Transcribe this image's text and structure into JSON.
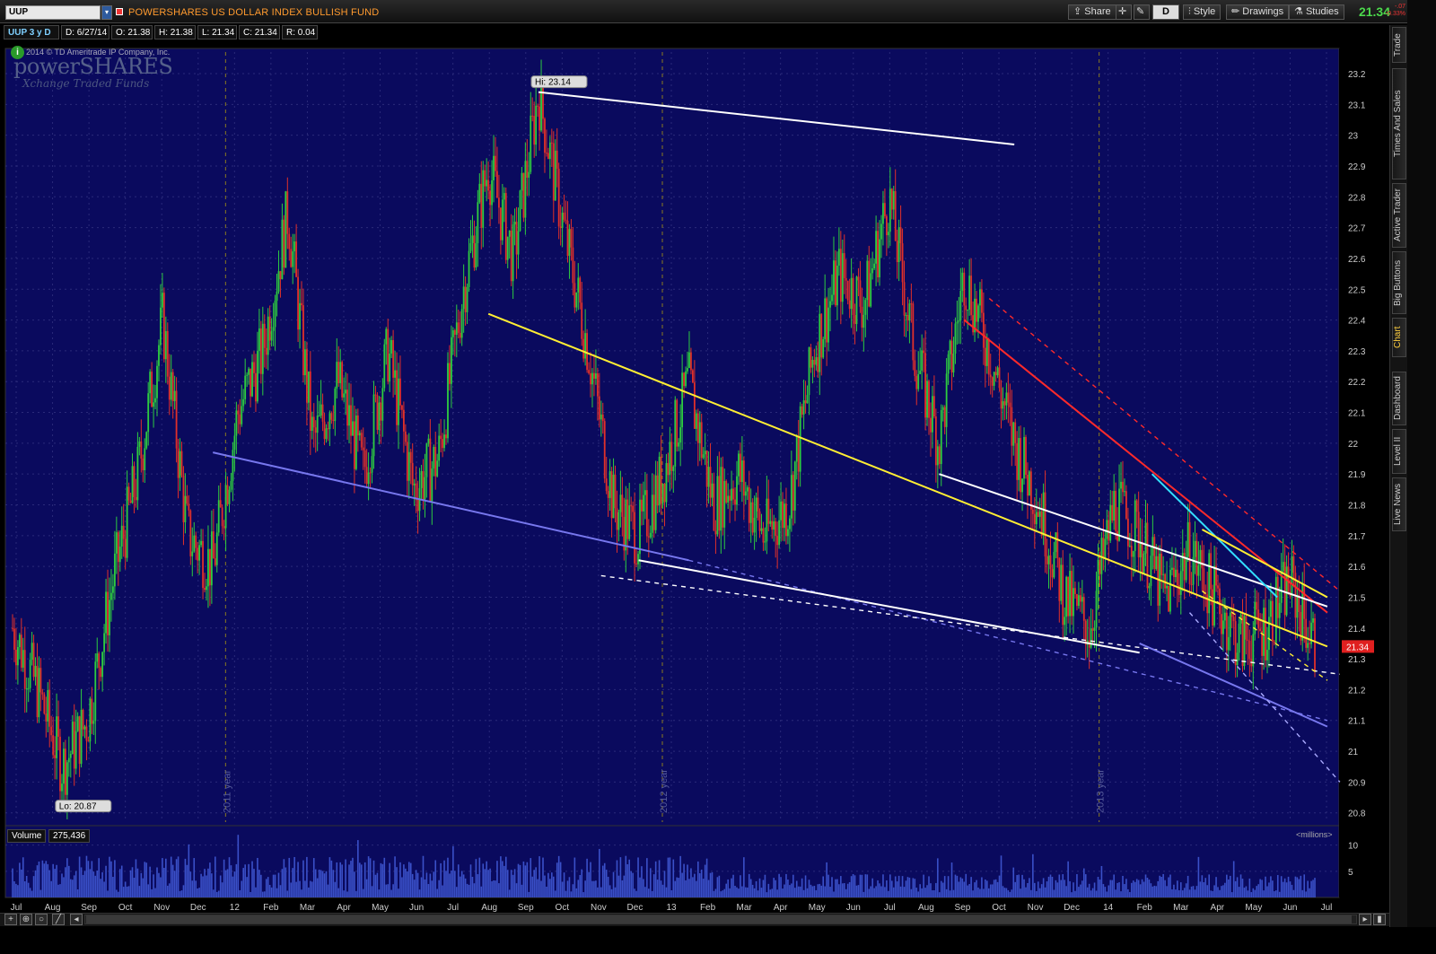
{
  "toolbar": {
    "symbol": "UUP",
    "fund_name": "POWERSHARES US DOLLAR INDEX BULLISH FUND",
    "share_label": "Share",
    "d_label": "D",
    "style_label": "Style",
    "drawings_label": "Drawings",
    "studies_label": "Studies",
    "last_price": "21.34",
    "change_line1": "-.07",
    "change_line2": "-0.33%"
  },
  "infobar": {
    "symbol_period": "UUP 3 y D",
    "date": "D: 6/27/14",
    "open": "O: 21.38",
    "high": "H: 21.38",
    "low": "L: 21.34",
    "close": "C: 21.34",
    "range": "R: 0.04"
  },
  "logo": {
    "copyright": "2014 © TD Ameritrade IP Company, Inc.",
    "brand": "powerSHARES",
    "brand_sub": "Xchange Traded Funds"
  },
  "side_tabs": [
    "Trade",
    "Times And Sales",
    "Active Trader",
    "Big Buttons",
    "Chart",
    "Dashboard",
    "Level II",
    "Live News"
  ],
  "volume": {
    "label": "Volume",
    "value": "275,436",
    "units": "<millions>",
    "ticks": [
      "10",
      "5"
    ]
  },
  "colors": {
    "chart_bg": "#0a0a5e",
    "grid": "#2a2a7a",
    "up_candle": "#2ecc40",
    "down_candle": "#e0302a",
    "last_price_badge": "#e02020"
  },
  "chart_data": {
    "type": "candlestick",
    "y_ticks": [
      "23.2",
      "23.1",
      "23",
      "22.9",
      "22.8",
      "22.7",
      "22.6",
      "22.5",
      "22.4",
      "22.3",
      "22.2",
      "22.1",
      "22",
      "21.9",
      "21.8",
      "21.7",
      "21.6",
      "21.5",
      "21.4",
      "21.3",
      "21.2",
      "21.1",
      "21",
      "20.9",
      "20.8"
    ],
    "ylim": [
      20.77,
      23.27
    ],
    "x_ticks": [
      "Jul",
      "Aug",
      "Sep",
      "Oct",
      "Nov",
      "Dec",
      "12",
      "Feb",
      "Mar",
      "Apr",
      "May",
      "Jun",
      "Jul",
      "Aug",
      "Sep",
      "Oct",
      "Nov",
      "Dec",
      "13",
      "Feb",
      "Mar",
      "Apr",
      "May",
      "Jun",
      "Jul",
      "Aug",
      "Sep",
      "Oct",
      "Nov",
      "Dec",
      "14",
      "Feb",
      "Mar",
      "Apr",
      "May",
      "Jun",
      "Jul"
    ],
    "year_labels": [
      "2011 year",
      "2012 year",
      "2013 year"
    ],
    "high_label": "Hi: 23.14",
    "low_label": "Lo: 20.87",
    "last_price_label": "21.34",
    "price_path": [
      [
        0,
        21.4
      ],
      [
        1,
        21.2
      ],
      [
        2,
        20.95
      ],
      [
        3,
        21.1
      ],
      [
        4,
        21.55
      ],
      [
        5,
        21.9
      ],
      [
        6,
        22.4
      ],
      [
        7,
        21.7
      ],
      [
        8,
        21.6
      ],
      [
        9,
        22.1
      ],
      [
        10,
        22.3
      ],
      [
        11,
        22.75
      ],
      [
        12,
        22.0
      ],
      [
        13,
        22.2
      ],
      [
        14,
        21.9
      ],
      [
        15,
        22.3
      ],
      [
        16,
        21.85
      ],
      [
        17,
        21.95
      ],
      [
        18,
        22.5
      ],
      [
        19,
        22.9
      ],
      [
        20,
        22.6
      ],
      [
        21,
        23.14
      ],
      [
        22,
        22.7
      ],
      [
        23,
        22.3
      ],
      [
        24,
        21.8
      ],
      [
        25,
        21.7
      ],
      [
        26,
        21.9
      ],
      [
        27,
        22.2
      ],
      [
        28,
        21.8
      ],
      [
        29,
        21.9
      ],
      [
        30,
        21.7
      ],
      [
        31,
        21.8
      ],
      [
        32,
        22.3
      ],
      [
        33,
        22.55
      ],
      [
        34,
        22.45
      ],
      [
        35,
        22.8
      ],
      [
        36,
        22.3
      ],
      [
        37,
        22.0
      ],
      [
        38,
        22.55
      ],
      [
        39,
        22.3
      ],
      [
        40,
        22.0
      ],
      [
        41,
        21.8
      ],
      [
        42,
        21.5
      ],
      [
        43,
        21.4
      ],
      [
        44,
        21.8
      ],
      [
        45,
        21.7
      ],
      [
        46,
        21.5
      ],
      [
        47,
        21.65
      ],
      [
        48,
        21.5
      ],
      [
        49,
        21.35
      ],
      [
        50,
        21.4
      ],
      [
        51,
        21.55
      ],
      [
        52,
        21.34
      ]
    ],
    "trendlines": [
      {
        "color": "#ffffff",
        "from": [
          21,
          23.14
        ],
        "to": [
          40,
          22.97
        ],
        "style": "solid"
      },
      {
        "color": "#ffee33",
        "from": [
          19,
          22.42
        ],
        "to": [
          52.5,
          21.34
        ],
        "style": "solid"
      },
      {
        "color": "#7777ee",
        "from": [
          8,
          21.97
        ],
        "to": [
          27,
          21.62
        ],
        "style": "solid"
      },
      {
        "color": "#7777ee",
        "from": [
          27,
          21.62
        ],
        "to": [
          52.5,
          21.1
        ],
        "style": "dashed"
      },
      {
        "color": "#ffffff",
        "from": [
          25,
          21.62
        ],
        "to": [
          45,
          21.32
        ],
        "style": "solid"
      },
      {
        "color": "#ffffff",
        "from": [
          23.5,
          21.57
        ],
        "to": [
          53,
          21.25
        ],
        "style": "dashed"
      },
      {
        "color": "#ff2a2a",
        "from": [
          38,
          22.4
        ],
        "to": [
          52.5,
          21.45
        ],
        "style": "solid"
      },
      {
        "color": "#ff2a2a",
        "from": [
          39,
          22.47
        ],
        "to": [
          53,
          21.52
        ],
        "style": "dashed"
      },
      {
        "color": "#ffffff",
        "from": [
          37,
          21.9
        ],
        "to": [
          52.5,
          21.47
        ],
        "style": "solid"
      },
      {
        "color": "#33e0ff",
        "from": [
          45.5,
          21.9
        ],
        "to": [
          50.5,
          21.5
        ],
        "style": "solid"
      },
      {
        "color": "#7777ee",
        "from": [
          45,
          21.35
        ],
        "to": [
          52.5,
          21.08
        ],
        "style": "solid"
      },
      {
        "color": "#ffee33",
        "from": [
          47.5,
          21.52
        ],
        "to": [
          52.5,
          21.23
        ],
        "style": "dashed"
      },
      {
        "color": "#ffee33",
        "from": [
          47.5,
          21.72
        ],
        "to": [
          52.5,
          21.5
        ],
        "style": "solid"
      },
      {
        "color": "#aaaaff",
        "from": [
          47,
          21.45
        ],
        "to": [
          53,
          20.9
        ],
        "style": "dashed"
      }
    ],
    "volume_ylim": [
      0,
      12
    ],
    "grid": true
  }
}
